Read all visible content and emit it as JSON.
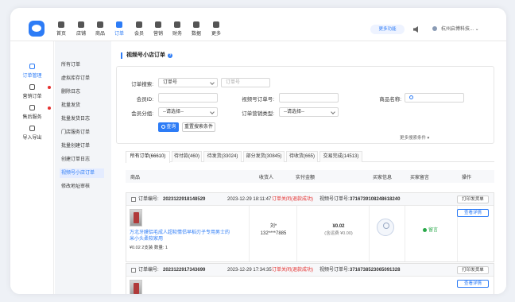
{
  "topnav": {
    "items": [
      {
        "label": "首页"
      },
      {
        "label": "店铺"
      },
      {
        "label": "商品"
      },
      {
        "label": "订单"
      },
      {
        "label": "会员"
      },
      {
        "label": "营销"
      },
      {
        "label": "财务"
      },
      {
        "label": "数据"
      },
      {
        "label": "更多"
      }
    ],
    "active": "订单",
    "more_features": "更多功能",
    "shop_name": "杭州启博科技..."
  },
  "sidebar": {
    "items": [
      {
        "label": "订单管理",
        "active": true
      },
      {
        "label": "营销订单",
        "badge": true
      },
      {
        "label": "售后服务",
        "badge": true
      },
      {
        "label": "导入导出"
      }
    ]
  },
  "submenu": {
    "items": [
      "所有订单",
      "虚拟库存订单",
      "删除日志",
      "批量发货",
      "批量发货日志",
      "门店服务订单",
      "批量创建订单",
      "创建订单日志",
      "视频号小店订单",
      "修改地址审核"
    ],
    "active": "视频号小店订单"
  },
  "page": {
    "title": "视频号小店订单",
    "help": "?"
  },
  "search": {
    "search_label": "订单搜索:",
    "search_type": "订单号",
    "search_placeholder": "订单号",
    "member_label": "会员ID:",
    "member_group_label": "会员分组:",
    "member_group_value": "--请选择--",
    "video_order_label": "视频号订单号:",
    "order_type_label": "订单营销类型:",
    "order_type_value": "--请选择--",
    "product_label": "商品名称:",
    "query_btn": "查询",
    "reset_btn": "重置搜索条件",
    "more_conditions": "更多搜索条件 ▾"
  },
  "tabs": [
    {
      "label": "所有订单(66610)",
      "active": true
    },
    {
      "label": "待付款(460)"
    },
    {
      "label": "待发货(33024)"
    },
    {
      "label": "部分发货(30845)"
    },
    {
      "label": "待收货(665)"
    },
    {
      "label": "交易完成(14513)"
    }
  ],
  "table_header": [
    "商品",
    "收货人",
    "实付金额",
    "买家信息",
    "买家留言",
    "操作"
  ],
  "orders": [
    {
      "order_no_label": "订单编号:",
      "order_no": "2023122918148529",
      "time": "2023-12-29 18:11:47",
      "status": "订单关闭(退款成功)",
      "video_no_label": "视频号订单号:",
      "video_no": "3716739108248618240",
      "print_btn": "打印发货单",
      "product_name": "万北牙膜铝毛成人超软情侣早稻刃子专用男士的米小头柔软家用",
      "product_info": "¥0.02  2支装  数量: 1",
      "receiver_name": "刘*",
      "receiver_phone": "132****7885",
      "pay_amount": "¥0.02",
      "pay_note": "(含运费 ¥0.00)",
      "message": "留言",
      "detail_btn": "查看详情"
    },
    {
      "order_no_label": "订单编号:",
      "order_no": "2023122917343699",
      "time": "2023-12-29 17:34:35",
      "status": "订单关闭(退款成功)",
      "video_no_label": "视频号订单号:",
      "video_no": "3716738523065091328",
      "print_btn": "打印发货单",
      "detail_btn": "查看详情"
    }
  ],
  "colors": {
    "accent": "#2d7cf6",
    "danger": "#e5302f",
    "success": "#2aa84a"
  }
}
